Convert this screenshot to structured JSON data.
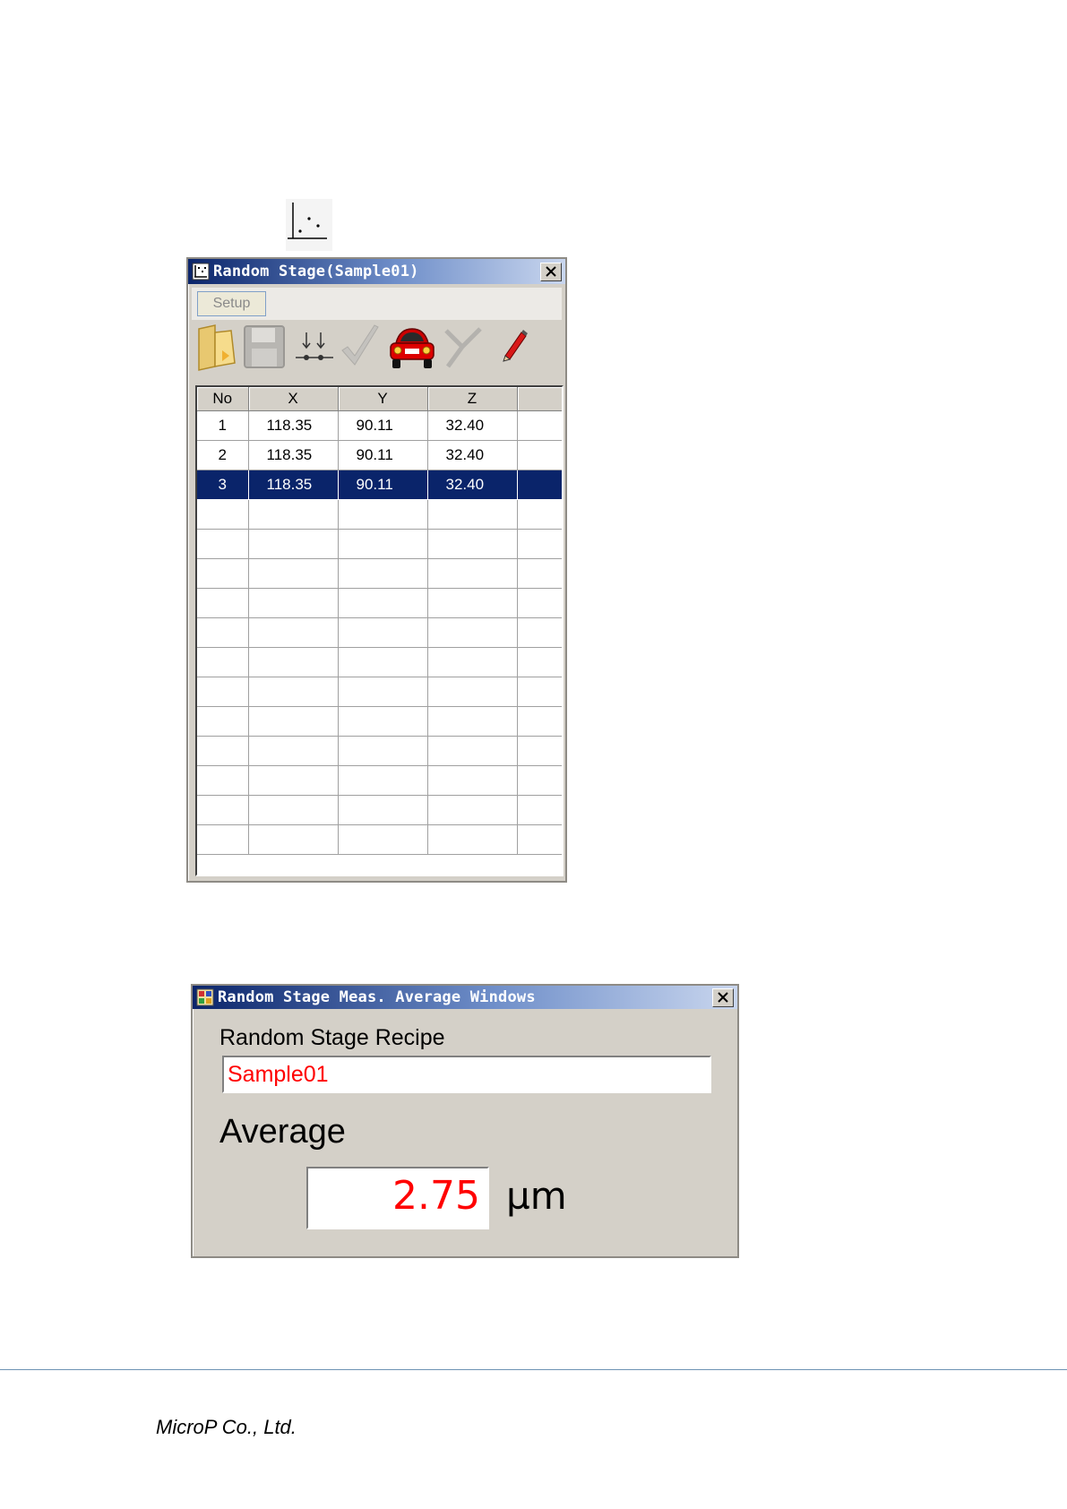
{
  "window1": {
    "title": "Random Stage(Sample01)",
    "setup_label": "Setup",
    "toolbar_icons": [
      "folder-open-icon",
      "save-disk-icon",
      "add-point-icon",
      "checkmark-icon",
      "car-move-icon",
      "delete-x-icon",
      "pencil-edit-icon"
    ],
    "columns": [
      "No",
      "X",
      "Y",
      "Z",
      ""
    ],
    "rows": [
      {
        "no": "1",
        "x": "118.35",
        "y": "90.11",
        "z": "32.40"
      },
      {
        "no": "2",
        "x": "118.35",
        "y": "90.11",
        "z": "32.40"
      },
      {
        "no": "3",
        "x": "118.35",
        "y": "90.11",
        "z": "32.40"
      }
    ],
    "selected_row": 3,
    "empty_rows": 12,
    "selection_color": "#0a246a"
  },
  "window2": {
    "title": "Random Stage Meas. Average Windows",
    "recipe_label": "Random Stage Recipe",
    "recipe_value": "Sample01",
    "average_label": "Average",
    "average_value": "2.75",
    "unit": "µm",
    "value_color": "#ff0000"
  },
  "footer": {
    "company": "MicroP Co., Ltd."
  }
}
